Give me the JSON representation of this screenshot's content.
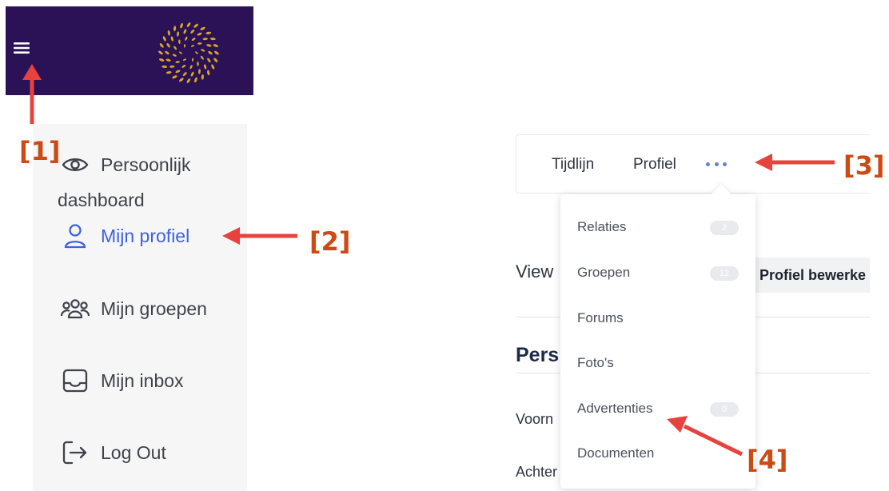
{
  "header": {
    "bg_color": "#2b1257",
    "logo_color": "#d9a628",
    "menu_icon": "hamburger-icon"
  },
  "sidebar": {
    "items": [
      {
        "label_line1": "Persoonlijk",
        "label_line2": "dashboard",
        "icon": "eye-icon"
      },
      {
        "label": "Mijn profiel",
        "icon": "user-icon",
        "active": true,
        "active_color": "#3d62e0"
      },
      {
        "label": "Mijn groepen",
        "icon": "users-group-icon"
      },
      {
        "label": "Mijn inbox",
        "icon": "inbox-icon"
      },
      {
        "label": "Log Out",
        "icon": "logout-icon"
      }
    ]
  },
  "profile_nav": {
    "tabs": [
      {
        "label": "Tijdlijn"
      },
      {
        "label": "Profiel"
      }
    ],
    "more_icon": "more-dots-icon"
  },
  "dropdown": {
    "items": [
      {
        "label": "Relaties",
        "badge": "2"
      },
      {
        "label": "Groepen",
        "badge": "12"
      },
      {
        "label": "Forums"
      },
      {
        "label": "Foto's"
      },
      {
        "label": "Advertenties",
        "badge": "0"
      },
      {
        "label": "Documenten"
      }
    ]
  },
  "underlay": {
    "view_label": "View",
    "edit_button": "Profiel bewerke",
    "section_heading": "Pers",
    "field_1": "Voorn",
    "field_2": "Achter"
  },
  "annotations": [
    "[1]",
    "[2]",
    "[3]",
    "[4]"
  ],
  "colors": {
    "arrow": "#e8423f",
    "annotation_text": "#cc4a14"
  }
}
